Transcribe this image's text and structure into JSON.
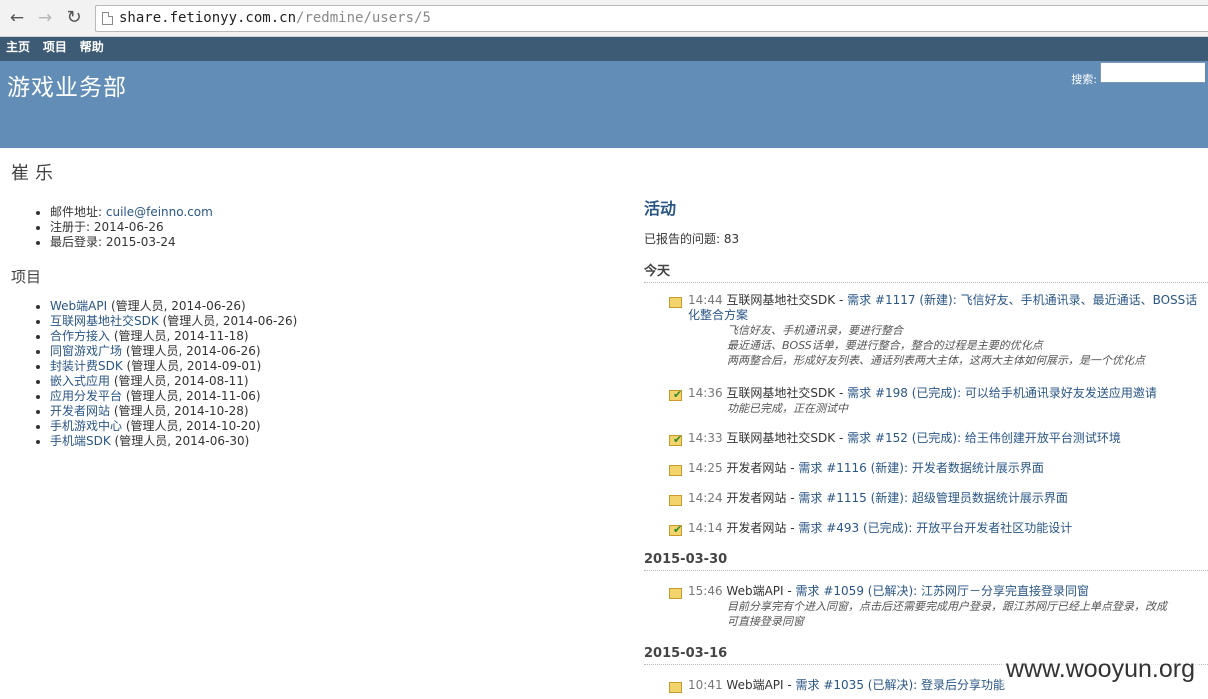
{
  "browser": {
    "url_host": "share.fetionyy.com.cn",
    "url_path": "/redmine/users/5"
  },
  "topmenu": [
    "主页",
    "项目",
    "帮助"
  ],
  "header": {
    "title": "游戏业务部",
    "search_label": "搜索:"
  },
  "user": {
    "name": "崔乐",
    "email_label": "邮件地址: ",
    "email": "cuile@feinno.com",
    "registered": "注册于: 2014-06-26",
    "last_login": "最后登录: 2015-03-24"
  },
  "projects": {
    "heading": "项目",
    "items": [
      {
        "name": "Web端API",
        "role": " (管理人员, 2014-06-26)"
      },
      {
        "name": "互联网基地社交SDK",
        "role": " (管理人员, 2014-06-26)"
      },
      {
        "name": "合作方接入",
        "role": " (管理人员, 2014-11-18)"
      },
      {
        "name": "同窗游戏广场",
        "role": " (管理人员, 2014-06-26)"
      },
      {
        "name": "封装计费SDK",
        "role": " (管理人员, 2014-09-01)"
      },
      {
        "name": "嵌入式应用",
        "role": " (管理人员, 2014-08-11)"
      },
      {
        "name": "应用分发平台",
        "role": " (管理人员, 2014-11-06)"
      },
      {
        "name": "开发者网站",
        "role": " (管理人员, 2014-10-28)"
      },
      {
        "name": "手机游戏中心",
        "role": " (管理人员, 2014-10-20)"
      },
      {
        "name": "手机端SDK",
        "role": " (管理人员, 2014-06-30)"
      }
    ]
  },
  "activity": {
    "title": "活动",
    "reported": "已报告的问题: 83",
    "days": [
      {
        "label": "今天"
      },
      {
        "label": "2015-03-30"
      },
      {
        "label": "2015-03-16"
      }
    ],
    "entries": [
      {
        "time": "14:44",
        "project": "互联网基地社交SDK",
        "link": "需求 #1117 (新建): 飞信好友、手机通讯录、最近通话、BOSS话",
        "link2": "化整合方案",
        "desc": [
          "飞信好友、手机通讯录，要进行整合",
          "最近通话、BOSS话单，要进行整合，整合的过程是主要的优化点",
          "两两整合后，形成好友列表、通话列表两大主体，这两大主体如何展示，是一个优化点"
        ],
        "status": "new"
      },
      {
        "time": "14:36",
        "project": "互联网基地社交SDK",
        "link": "需求 #198 (已完成): 可以给手机通讯录好友发送应用邀请",
        "desc": [
          "功能已完成，正在测试中"
        ],
        "status": "done"
      },
      {
        "time": "14:33",
        "project": "互联网基地社交SDK",
        "link": "需求 #152 (已完成): 给王伟创建开放平台测试环境",
        "desc": [],
        "status": "done"
      },
      {
        "time": "14:25",
        "project": "开发者网站",
        "link": "需求 #1116 (新建): 开发者数据统计展示界面",
        "desc": [],
        "status": "new"
      },
      {
        "time": "14:24",
        "project": "开发者网站",
        "link": "需求 #1115 (新建): 超级管理员数据统计展示界面",
        "desc": [],
        "status": "new"
      },
      {
        "time": "14:14",
        "project": "开发者网站",
        "link": "需求 #493 (已完成): 开放平台开发者社区功能设计",
        "desc": [],
        "status": "done"
      },
      {
        "time": "15:46",
        "project": "Web端API",
        "link": "需求 #1059 (已解决): 江苏网厅－分享完直接登录同窗",
        "desc": [
          "目前分享完有个进入同窗，点击后还需要完成用户登录，跟江苏网厅已经上单点登录，改成",
          "可直接登录同窗"
        ],
        "status": "new"
      },
      {
        "time": "10:41",
        "project": "Web端API",
        "link": "需求 #1035 (已解决): 登录后分享功能",
        "desc": [],
        "status": "new"
      }
    ]
  },
  "watermark": "www.wooyun.org"
}
